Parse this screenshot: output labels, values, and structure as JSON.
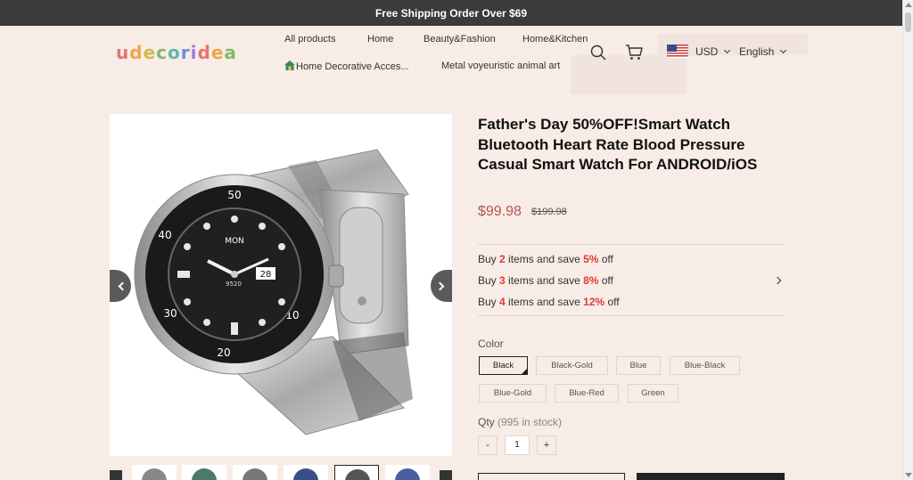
{
  "announcement": "Free Shipping Order Over $69",
  "brand": {
    "logo_letters": [
      "u",
      "d",
      "e",
      "c",
      "o",
      "r",
      "i",
      "d",
      "e",
      "a"
    ]
  },
  "nav": {
    "all_products": "All products",
    "home": "Home",
    "beauty": "Beauty&Fashion",
    "home_kitchen": "Home&Kitchen",
    "home_decorative": "Home Decorative Acces...",
    "metal_art": "Metal voyeuristic animal art"
  },
  "header": {
    "icons": [
      "search-icon",
      "cart-icon"
    ],
    "currency": "USD",
    "language": "English"
  },
  "product": {
    "title": "Father's Day 50%OFF!Smart Watch Bluetooth Heart Rate Blood Pressure Casual Smart Watch For ANDROID/iOS",
    "price": "$99.98",
    "compare_price": "$199.98",
    "watch_face": {
      "brand": "MON",
      "date": "28",
      "steps": "9520",
      "numerals": [
        "50",
        "40",
        "30",
        "20",
        "10"
      ]
    }
  },
  "tiers": [
    {
      "prefix": "Buy ",
      "qty": "2",
      "middle": " items and save ",
      "pct": "5%",
      "suffix": " off"
    },
    {
      "prefix": "Buy ",
      "qty": "3",
      "middle": " items and save ",
      "pct": "8%",
      "suffix": " off"
    },
    {
      "prefix": "Buy ",
      "qty": "4",
      "middle": " items and save ",
      "pct": "12%",
      "suffix": " off"
    }
  ],
  "color": {
    "label": "Color",
    "selected": "Black",
    "options": [
      "Black",
      "Black-Gold",
      "Blue",
      "Blue-Black",
      "Blue-Gold",
      "Blue-Red",
      "Green"
    ]
  },
  "quantity": {
    "label": "Qty",
    "stock": "(995 in stock)",
    "value": "1",
    "minus": "-",
    "plus": "+"
  },
  "thumbnails": {
    "count": 6,
    "selected_index": 4
  },
  "colors": {
    "accent_price": "#b85454",
    "tier_highlight": "#e03a3a",
    "topbar": "#3b3b3b",
    "page_bg": "#f7ece6"
  }
}
